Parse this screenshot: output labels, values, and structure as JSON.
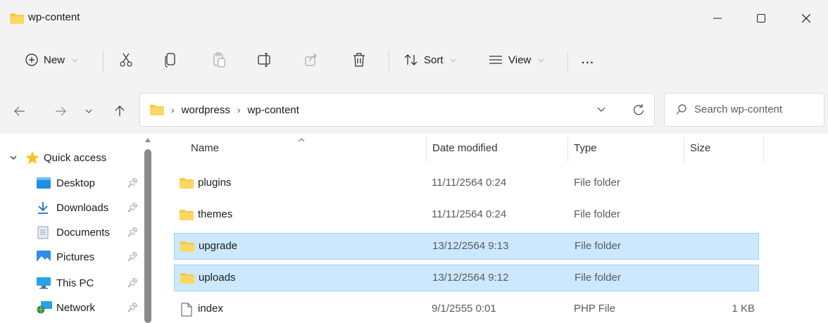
{
  "window": {
    "title": "wp-content",
    "minimize_icon": "minimize-icon",
    "maximize_icon": "maximize-icon",
    "close_icon": "close-icon"
  },
  "toolbar": {
    "new_label": "New",
    "sort_label": "Sort",
    "view_label": "View",
    "more_label": "...",
    "icons": [
      "cut-icon",
      "copy-icon",
      "paste-icon",
      "rename-icon",
      "share-icon",
      "delete-icon"
    ]
  },
  "nav": {
    "breadcrumbs": [
      "wordpress",
      "wp-content"
    ],
    "search_placeholder": "Search wp-content"
  },
  "sidebar": {
    "quick_access_label": "Quick access",
    "items": [
      {
        "label": "Desktop",
        "icon": "desktop-icon"
      },
      {
        "label": "Downloads",
        "icon": "download-icon"
      },
      {
        "label": "Documents",
        "icon": "documents-icon"
      },
      {
        "label": "Pictures",
        "icon": "pictures-icon"
      },
      {
        "label": "This PC",
        "icon": "computer-icon"
      },
      {
        "label": "Network",
        "icon": "network-icon"
      }
    ]
  },
  "list": {
    "columns": [
      "Name",
      "Date modified",
      "Type",
      "Size"
    ],
    "rows": [
      {
        "name": "plugins",
        "date": "11/11/2564 0:24",
        "type": "File folder",
        "size": "",
        "selected": false,
        "icon": "folder-icon"
      },
      {
        "name": "themes",
        "date": "11/11/2564 0:24",
        "type": "File folder",
        "size": "",
        "selected": false,
        "icon": "folder-icon"
      },
      {
        "name": "upgrade",
        "date": "13/12/2564 9:13",
        "type": "File folder",
        "size": "",
        "selected": true,
        "icon": "folder-icon"
      },
      {
        "name": "uploads",
        "date": "13/12/2564 9:12",
        "type": "File folder",
        "size": "",
        "selected": true,
        "icon": "folder-icon"
      },
      {
        "name": "index",
        "date": "9/1/2555 0:01",
        "type": "PHP File",
        "size": "1 KB",
        "selected": false,
        "icon": "file-icon"
      }
    ]
  },
  "colors": {
    "selection_bg": "#cce8ff",
    "selection_border": "#99d1ff",
    "folder": "#f8c845",
    "accent": "#0067c0"
  }
}
